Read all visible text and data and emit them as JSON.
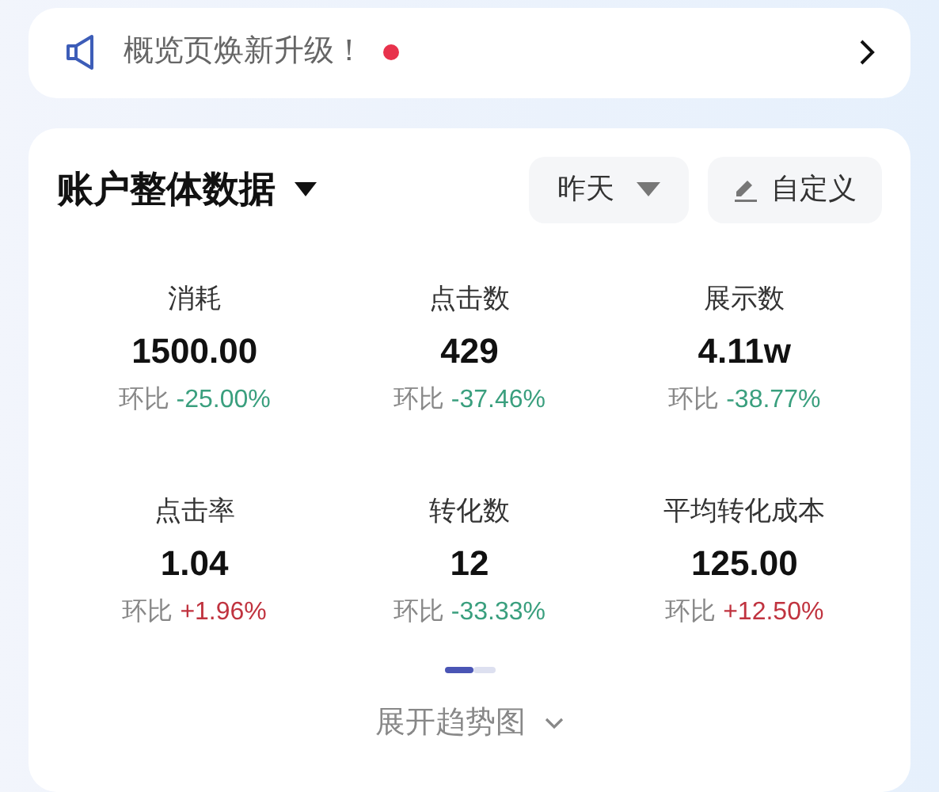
{
  "banner": {
    "text": "概览页焕新升级！",
    "unread": true
  },
  "card": {
    "title": "账户整体数据",
    "date_filter": "昨天",
    "customize": "自定义",
    "metrics": [
      {
        "label": "消耗",
        "value": "1500.00",
        "change_label": "环比",
        "change": "-25.00%",
        "color": "#3a9f7e"
      },
      {
        "label": "点击数",
        "value": "429",
        "change_label": "环比",
        "change": "-37.46%",
        "color": "#3a9f7e"
      },
      {
        "label": "展示数",
        "value": "4.11w",
        "change_label": "环比",
        "change": "-38.77%",
        "color": "#3a9f7e"
      },
      {
        "label": "点击率",
        "value": "1.04",
        "change_label": "环比",
        "change": "+1.96%",
        "color": "#c0333f"
      },
      {
        "label": "转化数",
        "value": "12",
        "change_label": "环比",
        "change": "-33.33%",
        "color": "#3a9f7e"
      },
      {
        "label": "平均转化成本",
        "value": "125.00",
        "change_label": "环比",
        "change": "+12.50%",
        "color": "#c0333f"
      }
    ],
    "pages": [
      {
        "selected": true
      },
      {
        "selected": false
      }
    ],
    "expand": "展开趋势图"
  }
}
